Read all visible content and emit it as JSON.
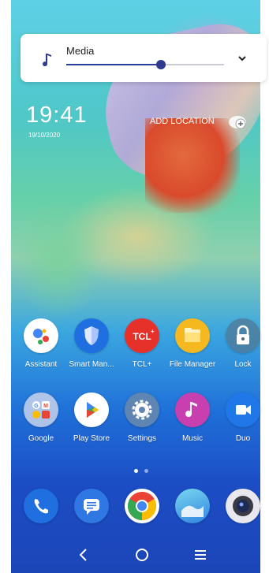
{
  "media_panel": {
    "label": "Media",
    "volume_level": 0.6
  },
  "clock": {
    "time": "19:41",
    "date": "19/10/2020",
    "add_location": "ADD LOCATION"
  },
  "home_row1": [
    {
      "label": "Assistant",
      "icon": "google-assistant-icon"
    },
    {
      "label": "Smart Man...",
      "icon": "smart-manager-icon"
    },
    {
      "label": "TCL+",
      "icon": "tcl-plus-icon"
    },
    {
      "label": "File Manager",
      "icon": "file-manager-icon"
    },
    {
      "label": "Lock",
      "icon": "lock-icon"
    }
  ],
  "home_row2": [
    {
      "label": "Google",
      "icon": "google-folder-icon"
    },
    {
      "label": "Play Store",
      "icon": "play-store-icon"
    },
    {
      "label": "Settings",
      "icon": "settings-icon"
    },
    {
      "label": "Music",
      "icon": "music-icon"
    },
    {
      "label": "Duo",
      "icon": "duo-icon"
    }
  ],
  "dock": [
    {
      "icon": "phone-icon"
    },
    {
      "icon": "messages-icon"
    },
    {
      "icon": "chrome-icon"
    },
    {
      "icon": "gallery-icon"
    },
    {
      "icon": "camera-icon"
    }
  ],
  "page_indicator": {
    "pages": 2,
    "current": 1
  },
  "colors": {
    "accent": "#2c3a8f",
    "tcl_red": "#e5312a",
    "file_yellow": "#f5b81e",
    "music_pink": "#c83fb0",
    "duo_blue": "#1f77e8"
  }
}
